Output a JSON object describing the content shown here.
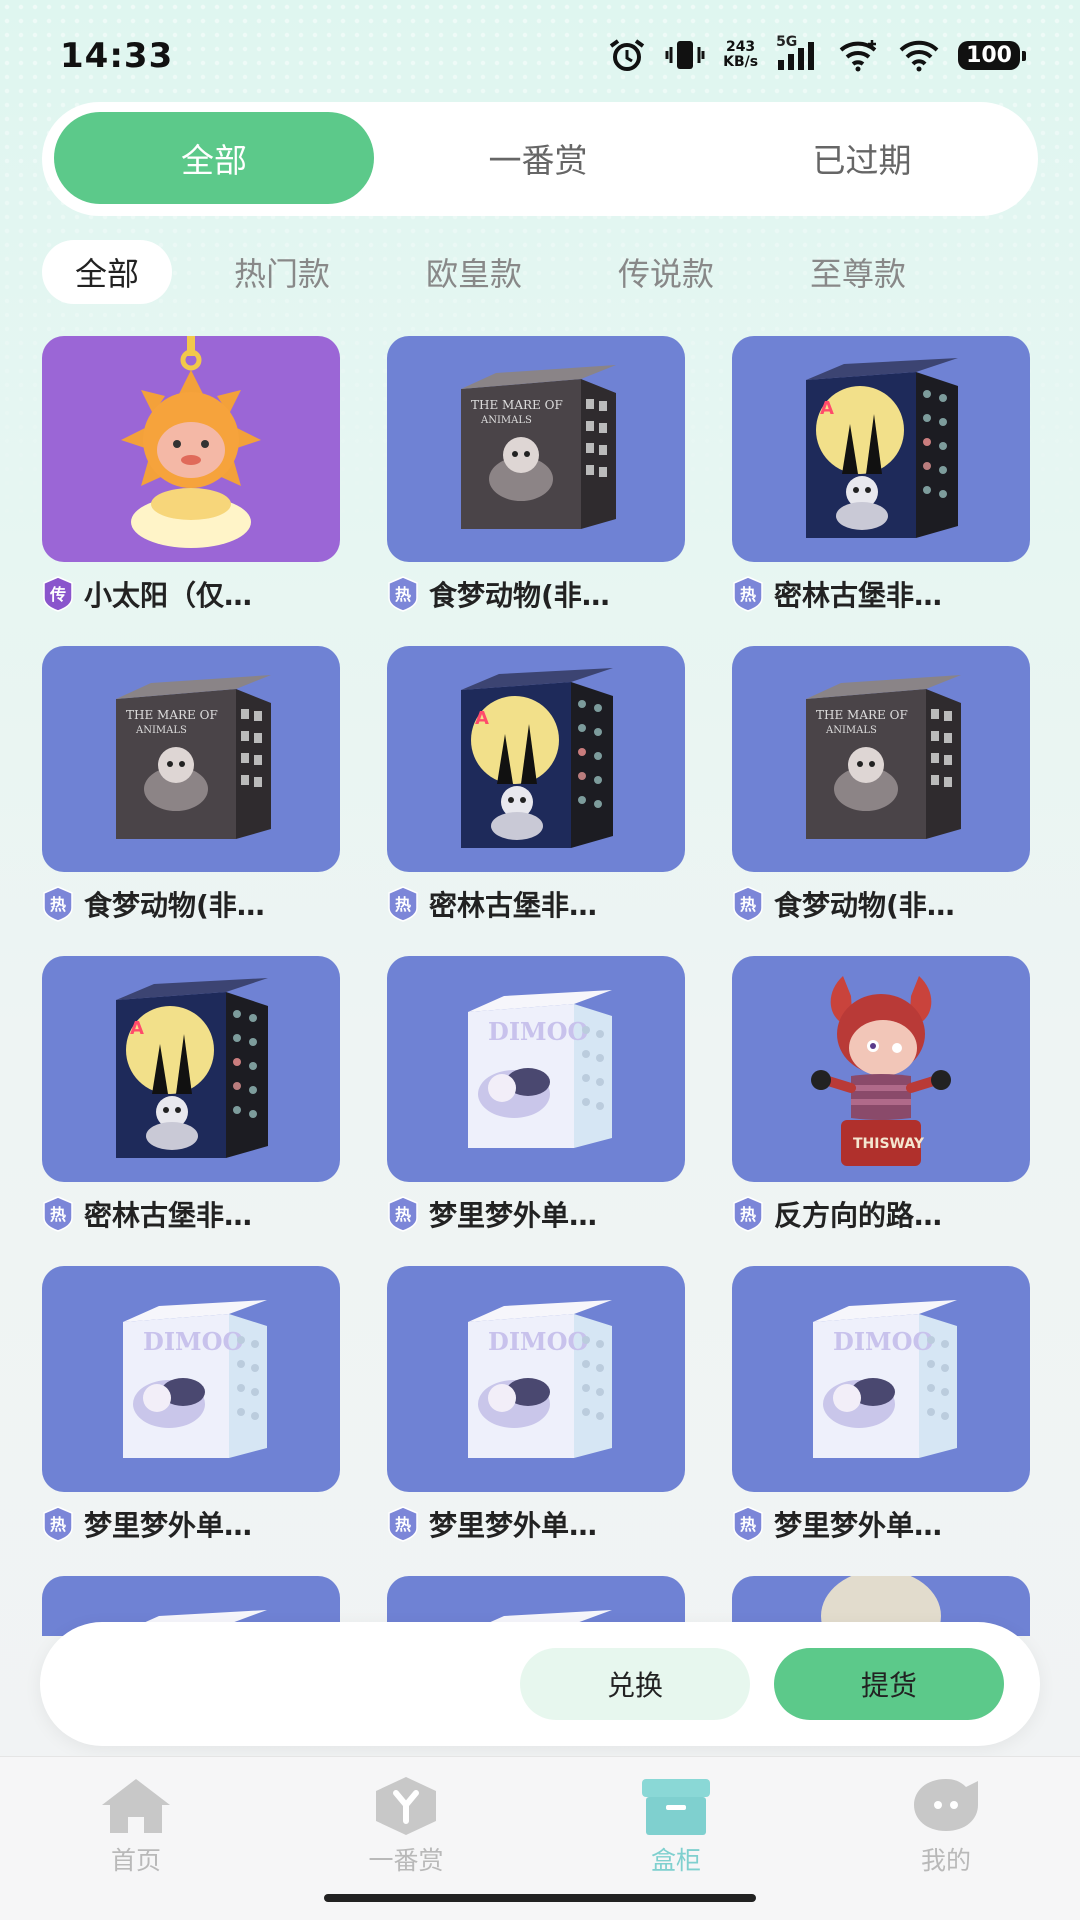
{
  "status_bar": {
    "time": "14:33",
    "speed_value": "243",
    "speed_unit": "KB/s",
    "network": "5G",
    "battery": "100"
  },
  "main_tabs": [
    {
      "label": "全部",
      "active": true
    },
    {
      "label": "一番赏",
      "active": false
    },
    {
      "label": "已过期",
      "active": false
    }
  ],
  "sub_filters": [
    {
      "label": "全部",
      "active": true
    },
    {
      "label": "热门款",
      "active": false
    },
    {
      "label": "欧皇款",
      "active": false
    },
    {
      "label": "传说款",
      "active": false
    },
    {
      "label": "至尊款",
      "active": false
    }
  ],
  "badges": {
    "hot": "热",
    "legend": "传"
  },
  "items": [
    {
      "title": "小太阳（仅…",
      "badge": "传",
      "image": "sun-plush-charm",
      "bg": "purple"
    },
    {
      "title": "食梦动物(非…",
      "badge": "热",
      "image": "mare-box",
      "bg": "blue"
    },
    {
      "title": "密林古堡非…",
      "badge": "热",
      "image": "castle-box",
      "bg": "blue"
    },
    {
      "title": "食梦动物(非…",
      "badge": "热",
      "image": "mare-box",
      "bg": "blue"
    },
    {
      "title": "密林古堡非…",
      "badge": "热",
      "image": "castle-box",
      "bg": "blue"
    },
    {
      "title": "食梦动物(非…",
      "badge": "热",
      "image": "mare-box",
      "bg": "blue"
    },
    {
      "title": "密林古堡非…",
      "badge": "热",
      "image": "castle-box",
      "bg": "blue"
    },
    {
      "title": "梦里梦外单…",
      "badge": "热",
      "image": "dimoo-box",
      "bg": "blue"
    },
    {
      "title": "反方向的路…",
      "badge": "热",
      "image": "jack-in-box-figure",
      "bg": "blue"
    },
    {
      "title": "梦里梦外单…",
      "badge": "热",
      "image": "dimoo-box",
      "bg": "blue"
    },
    {
      "title": "梦里梦外单…",
      "badge": "热",
      "image": "dimoo-box",
      "bg": "blue"
    },
    {
      "title": "梦里梦外单…",
      "badge": "热",
      "image": "dimoo-box",
      "bg": "blue"
    },
    {
      "title": "",
      "badge": "",
      "image": "dimoo-box",
      "bg": "blue"
    },
    {
      "title": "",
      "badge": "",
      "image": "dimoo-box",
      "bg": "blue"
    },
    {
      "title": "",
      "badge": "",
      "image": "figure-partial",
      "bg": "blue"
    }
  ],
  "actions": {
    "exchange": "兑换",
    "pickup": "提货"
  },
  "tab_bar": [
    {
      "label": "首页",
      "icon": "home-icon",
      "active": false
    },
    {
      "label": "一番赏",
      "icon": "cube-y-icon",
      "active": false
    },
    {
      "label": "盒柜",
      "icon": "box-cabinet-icon",
      "active": true
    },
    {
      "label": "我的",
      "icon": "chat-face-icon",
      "active": false
    }
  ],
  "colors": {
    "accent_green": "#5cc98a",
    "card_blue": "#6f82d4",
    "card_purple": "#9b66d6",
    "tab_active": "#7fd0cf",
    "badge_hot": "#7c86d8",
    "badge_legend": "#8a55cc"
  }
}
